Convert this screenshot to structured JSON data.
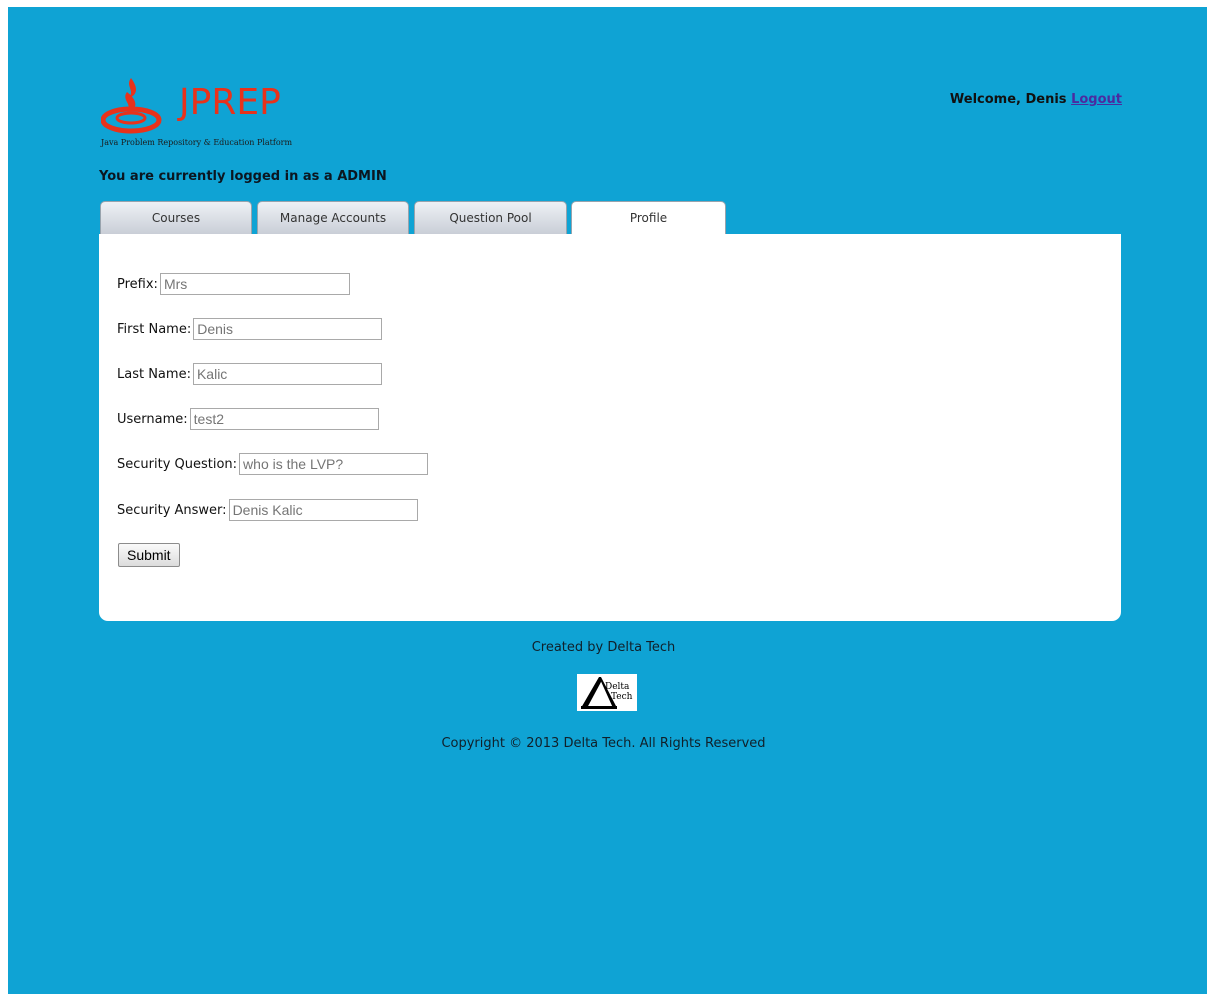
{
  "logo": {
    "name": "JPREP",
    "tagline": "Java Problem Repository & Education Platform",
    "brand_color": "#e8321b"
  },
  "header": {
    "welcome_text": "Welcome, Denis",
    "logout_label": "Logout",
    "login_status": "You are currently logged in as a ADMIN"
  },
  "tabs": [
    {
      "label": "Courses",
      "active": false
    },
    {
      "label": "Manage Accounts",
      "active": false
    },
    {
      "label": "Question Pool",
      "active": false
    },
    {
      "label": "Profile",
      "active": true
    }
  ],
  "form": {
    "fields": [
      {
        "label": "Prefix:",
        "placeholder": "Mrs"
      },
      {
        "label": "First Name:",
        "placeholder": "Denis"
      },
      {
        "label": "Last Name:",
        "placeholder": "Kalic"
      },
      {
        "label": "Username:",
        "placeholder": "test2"
      },
      {
        "label": "Security Question:",
        "placeholder": "who is the LVP?"
      },
      {
        "label": "Security Answer:",
        "placeholder": "Denis Kalic"
      }
    ],
    "submit_label": "Submit"
  },
  "footer": {
    "created_by": "Created by Delta Tech",
    "delta_logo_line1": "Delta",
    "delta_logo_line2": "Tech",
    "copyright": "Copyright © 2013 Delta Tech. All Rights Reserved"
  },
  "colors": {
    "background": "#0fa3d4",
    "panel": "#ffffff",
    "link": "#4b2ba0"
  }
}
